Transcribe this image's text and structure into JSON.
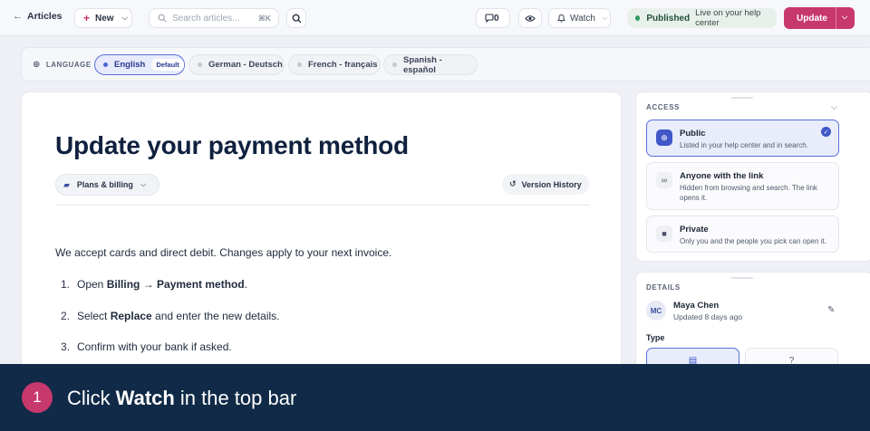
{
  "topbar": {
    "back_label": "Articles",
    "new_label": "New",
    "search_placeholder": "Search articles...",
    "search_shortcut": "⌘K",
    "comments_count": "0",
    "watch_label": "Watch",
    "status_label": "Published",
    "status_sub": "Live on your help center",
    "update_label": "Update"
  },
  "languages": {
    "title": "LANGUAGE",
    "default_badge": "Default",
    "items": [
      {
        "label": "English",
        "active": true
      },
      {
        "label": "German - Deutsch",
        "active": false
      },
      {
        "label": "French - français",
        "active": false
      },
      {
        "label": "Spanish - español",
        "active": false
      }
    ]
  },
  "article": {
    "title": "Update your payment method",
    "category": "Plans & billing",
    "version_history_label": "Version History",
    "intro": "We accept cards and direct debit. Changes apply to your next invoice.",
    "steps": [
      {
        "num": "1.",
        "pre": "Open ",
        "bold": "Billing → Payment method",
        "post": "."
      },
      {
        "num": "2.",
        "pre": "Select ",
        "bold": "Replace",
        "post": " and enter the new details."
      },
      {
        "num": "3.",
        "pre": "Confirm with your bank if asked.",
        "bold": "",
        "post": ""
      }
    ]
  },
  "access": {
    "title": "ACCESS",
    "options": [
      {
        "title": "Public",
        "desc": "Listed in your help center and in search.",
        "selected": true
      },
      {
        "title": "Anyone with the link",
        "desc": "Hidden from browsing and search. The link opens it.",
        "selected": false
      },
      {
        "title": "Private",
        "desc": "Only you and the people you pick can open it.",
        "selected": false
      }
    ]
  },
  "details": {
    "title": "DETAILS",
    "avatar_initials": "MC",
    "author": "Maya Chen",
    "updated": "Updated 8 days ago",
    "type_label": "Type"
  },
  "instruction": {
    "step": "1",
    "pre": "Click",
    "bold": "Watch",
    "post": "in the top bar"
  },
  "colors": {
    "accent": "#c7386d",
    "primary": "#3f57c9",
    "banner": "#102a47"
  }
}
